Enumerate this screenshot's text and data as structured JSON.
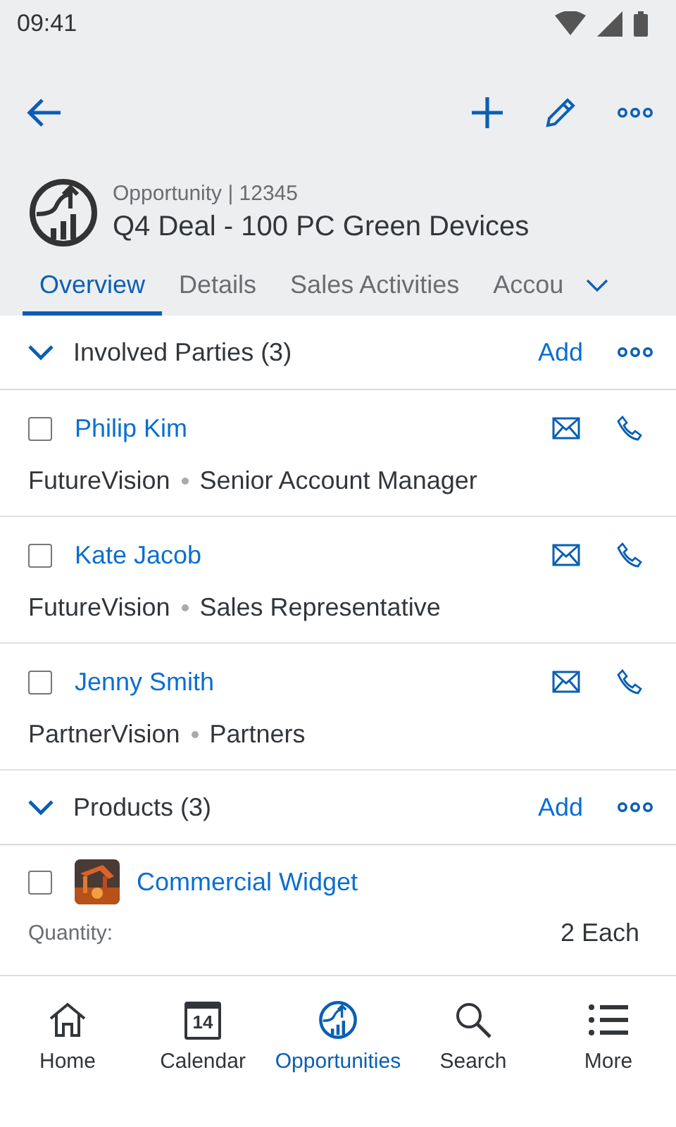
{
  "status_bar": {
    "time": "09:41"
  },
  "header": {
    "subtitle": "Opportunity | 12345",
    "title": "Q4 Deal - 100 PC Green Devices"
  },
  "tabs": [
    {
      "label": "Overview",
      "selected": true
    },
    {
      "label": "Details",
      "selected": false
    },
    {
      "label": "Sales Activities",
      "selected": false
    },
    {
      "label": "Accou",
      "selected": false
    }
  ],
  "sections": [
    {
      "title": "Involved Parties (3)",
      "expanded": true,
      "action": "Add",
      "items": [
        {
          "kind": "party",
          "name": "Philip Kim",
          "checked": false,
          "company": "FutureVision",
          "role": "Senior Account Manager"
        },
        {
          "kind": "party",
          "name": "Kate Jacob",
          "checked": false,
          "company": "FutureVision",
          "role": "Sales Representative"
        },
        {
          "kind": "party",
          "name": "Jenny Smith",
          "checked": false,
          "company": "PartnerVision",
          "role": "Partners"
        }
      ]
    },
    {
      "title": "Products (3)",
      "expanded": true,
      "action": "Add",
      "items": [
        {
          "kind": "product",
          "name": "Commercial Widget",
          "checked": false,
          "field_label": "Quantity:",
          "field_value": "2 Each"
        }
      ]
    }
  ],
  "bottom_nav": [
    {
      "label": "Home",
      "selected": false
    },
    {
      "label": "Calendar",
      "day": "14",
      "selected": false
    },
    {
      "label": "Opportunities",
      "selected": true
    },
    {
      "label": "Search",
      "selected": false
    },
    {
      "label": "More",
      "selected": false
    }
  ]
}
